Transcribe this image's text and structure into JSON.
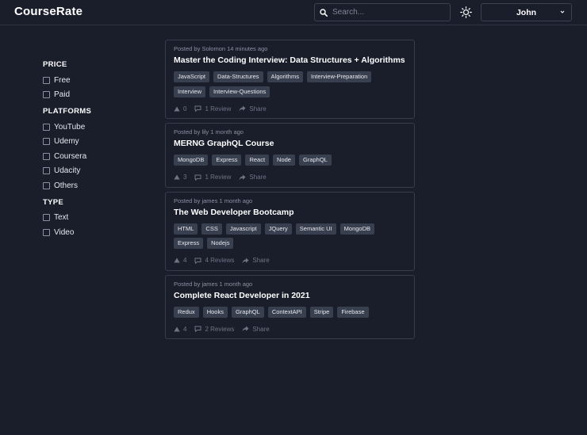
{
  "app": {
    "title": "CourseRate"
  },
  "search": {
    "placeholder": "Search..."
  },
  "user": {
    "name": "John"
  },
  "filters": {
    "price": {
      "title": "PRICE",
      "items": [
        "Free",
        "Paid"
      ]
    },
    "platforms": {
      "title": "PLATFORMS",
      "items": [
        "YouTube",
        "Udemy",
        "Coursera",
        "Udacity",
        "Others"
      ]
    },
    "type": {
      "title": "TYPE",
      "items": [
        "Text",
        "Video"
      ]
    }
  },
  "courses": [
    {
      "meta": "Posted by Solomon 14 minutes ago",
      "title": "Master the Coding Interview: Data Structures + Algorithms",
      "tags": [
        "JavaScript",
        "Data-Structures",
        "Algorithms",
        "Interview-Preparation",
        "Interview",
        "Interview-Questions"
      ],
      "votes": "0",
      "reviews": "1 Review",
      "share": "Share"
    },
    {
      "meta": "Posted by lily 1 month ago",
      "title": "MERNG GraphQL Course",
      "tags": [
        "MongoDB",
        "Express",
        "React",
        "Node",
        "GraphQL"
      ],
      "votes": "3",
      "reviews": "1 Review",
      "share": "Share"
    },
    {
      "meta": "Posted by james 1 month ago",
      "title": "The Web Developer Bootcamp",
      "tags": [
        "HTML",
        "CSS",
        "Javascript",
        "JQuery",
        "Semantic UI",
        "MongoDB",
        "Express",
        "Nodejs"
      ],
      "votes": "4",
      "reviews": "4 Reviews",
      "share": "Share"
    },
    {
      "meta": "Posted by james 1 month ago",
      "title": "Complete React Developer in 2021",
      "tags": [
        "Redux",
        "Hooks",
        "GraphQL",
        "ContextAPI",
        "Stripe",
        "Firebase"
      ],
      "votes": "4",
      "reviews": "2 Reviews",
      "share": "Share"
    }
  ],
  "icons": {
    "search": "search-icon",
    "theme": "sun-icon",
    "chevron": "chevron-down-icon",
    "upvote": "triangle-up-icon",
    "comment": "comment-icon",
    "share": "share-icon"
  },
  "colors": {
    "background": "#1a1e2b",
    "border": "#353c4d",
    "tag_bg": "#383f4f",
    "muted": "#8a91a2"
  }
}
